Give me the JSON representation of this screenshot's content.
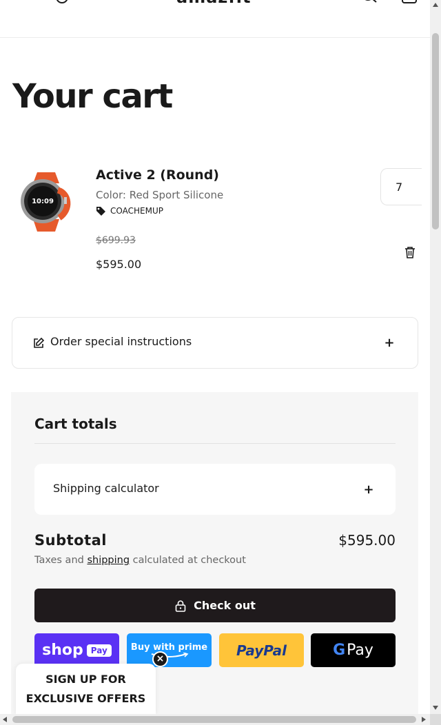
{
  "header": {
    "logo": "amazfit"
  },
  "page_title": "Your cart",
  "item": {
    "name": "Active 2 (Round)",
    "variant": "Color: Red Sport Silicone",
    "discount_code": "COACHEMUP",
    "original_price": "$699.93",
    "price": "$595.00",
    "quantity": "7"
  },
  "instructions": {
    "label": "Order special instructions",
    "toggle": "+"
  },
  "totals": {
    "title": "Cart totals",
    "shipping_calculator": "Shipping calculator",
    "shipping_toggle": "+",
    "subtotal_label": "Subtotal",
    "subtotal_value": "$595.00",
    "tax_note_pre": "Taxes and ",
    "tax_note_link": "shipping",
    "tax_note_post": " calculated at checkout",
    "checkout_label": "Check out"
  },
  "payment": {
    "shop_text": "shop",
    "shop_badge": "Pay",
    "prime_text": "Buy with prime",
    "paypal_text": "PayPal",
    "gpay_text": "Pay"
  },
  "signup": {
    "line1": "SIGN UP FOR",
    "line2": "EXCLUSIVE OFFERS",
    "close": "×"
  },
  "colors": {
    "checkout_bg": "#1f1a1c",
    "shop_pay": "#5a31f4",
    "prime": "#1a98ff",
    "paypal": "#ffc439",
    "totals_bg": "#f6f6f6"
  }
}
